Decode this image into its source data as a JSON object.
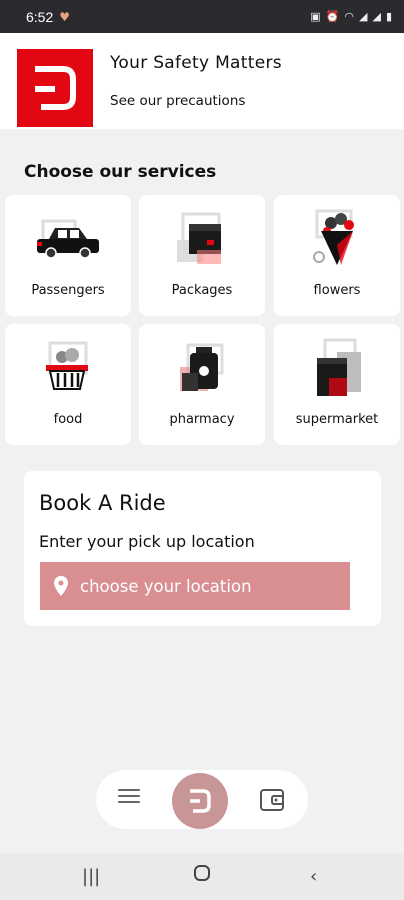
{
  "status_bar": {
    "time": "6:52"
  },
  "banner": {
    "title": "Your Safety Matters",
    "subtitle": "See our precautions"
  },
  "services": {
    "heading": "Choose our services",
    "items": [
      {
        "label": "Passengers"
      },
      {
        "label": "Packages"
      },
      {
        "label": "flowers"
      },
      {
        "label": "food"
      },
      {
        "label": "pharmacy"
      },
      {
        "label": "supermarket"
      }
    ]
  },
  "book_ride": {
    "title": "Book A Ride",
    "subtitle": "Enter your pick up location",
    "location_button": "choose your location"
  },
  "theme": {
    "brand_red": "#e30613",
    "button_pink": "#d98f91"
  },
  "icons": [
    "location-pin-icon",
    "menu-icon",
    "home-logo-icon",
    "wallet-icon",
    "recent-apps-icon",
    "home-icon",
    "back-icon"
  ]
}
